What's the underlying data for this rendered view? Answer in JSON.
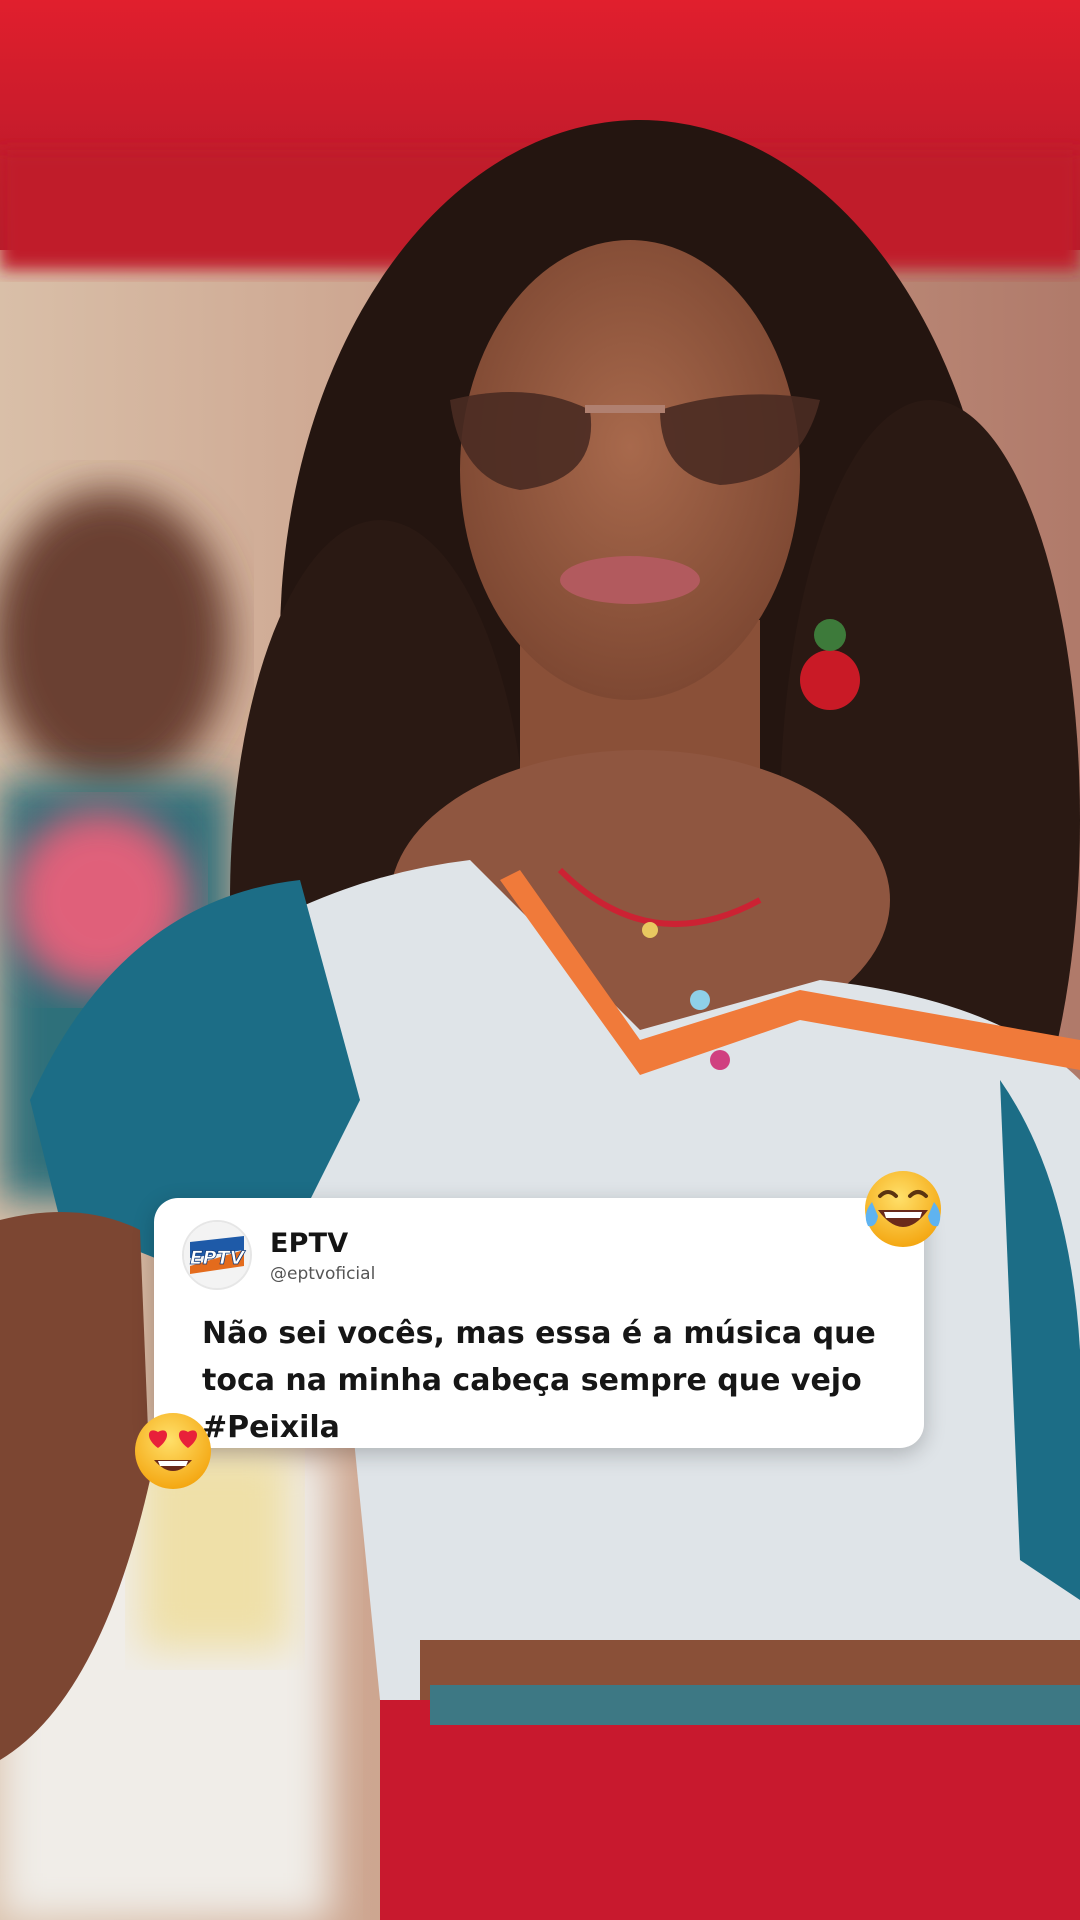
{
  "post": {
    "account_name": "EPTV",
    "handle": "@eptvoficial",
    "avatar_logo_text": "EPTV",
    "text": "Não sei vocês, mas essa é a música que toca na minha cabeça sempre que vejo #Peixila"
  },
  "emojis": [
    {
      "name": "face-with-tears-of-joy",
      "icon": "face-with-tears-of-joy-icon"
    },
    {
      "name": "heart-eyes",
      "icon": "heart-eyes-icon"
    }
  ],
  "colors": {
    "card_background": "#ffffff",
    "text": "#161616",
    "handle": "#555555",
    "background_red": "#d8202c"
  }
}
